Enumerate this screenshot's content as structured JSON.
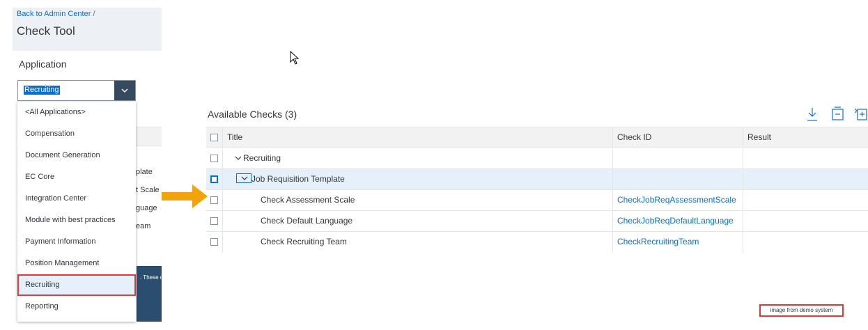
{
  "header": {
    "back_link": "Back to Admin Center",
    "separator": "/",
    "title": "Check Tool"
  },
  "application": {
    "label": "Application",
    "selected_value": "Recruiting",
    "options": [
      "<All Applications>",
      "Compensation",
      "Document Generation",
      "EC Core",
      "Integration Center",
      "Module with best practices",
      "Payment Information",
      "Position Management",
      "Recruiting",
      "Reporting"
    ]
  },
  "background_fragments": [
    "plate",
    "t Scale",
    "guage",
    "eam",
    ". These or"
  ],
  "checks": {
    "title": "Available Checks (3)",
    "toolbar_icons": [
      "download-icon",
      "collapse-all-icon",
      "expand-all-icon"
    ],
    "columns": [
      "Title",
      "Check ID",
      "Result"
    ],
    "rows": [
      {
        "title": "Recruiting",
        "check_id": "",
        "result": ""
      },
      {
        "title": "Job Requisition Template",
        "check_id": "",
        "result": ""
      },
      {
        "title": "Check Assessment Scale",
        "check_id": "CheckJobReqAssessmentScale",
        "result": ""
      },
      {
        "title": "Check Default Language",
        "check_id": "CheckJobReqDefaultLanguage",
        "result": ""
      },
      {
        "title": "Check Recruiting Team",
        "check_id": "CheckRecruitingTeam",
        "result": ""
      }
    ]
  },
  "watermark": "image from demo system",
  "colors": {
    "accent": "#0a6ed1",
    "highlight_border": "#e03a3a",
    "arrow": "#f0a30a",
    "shell": "#354a5f"
  }
}
